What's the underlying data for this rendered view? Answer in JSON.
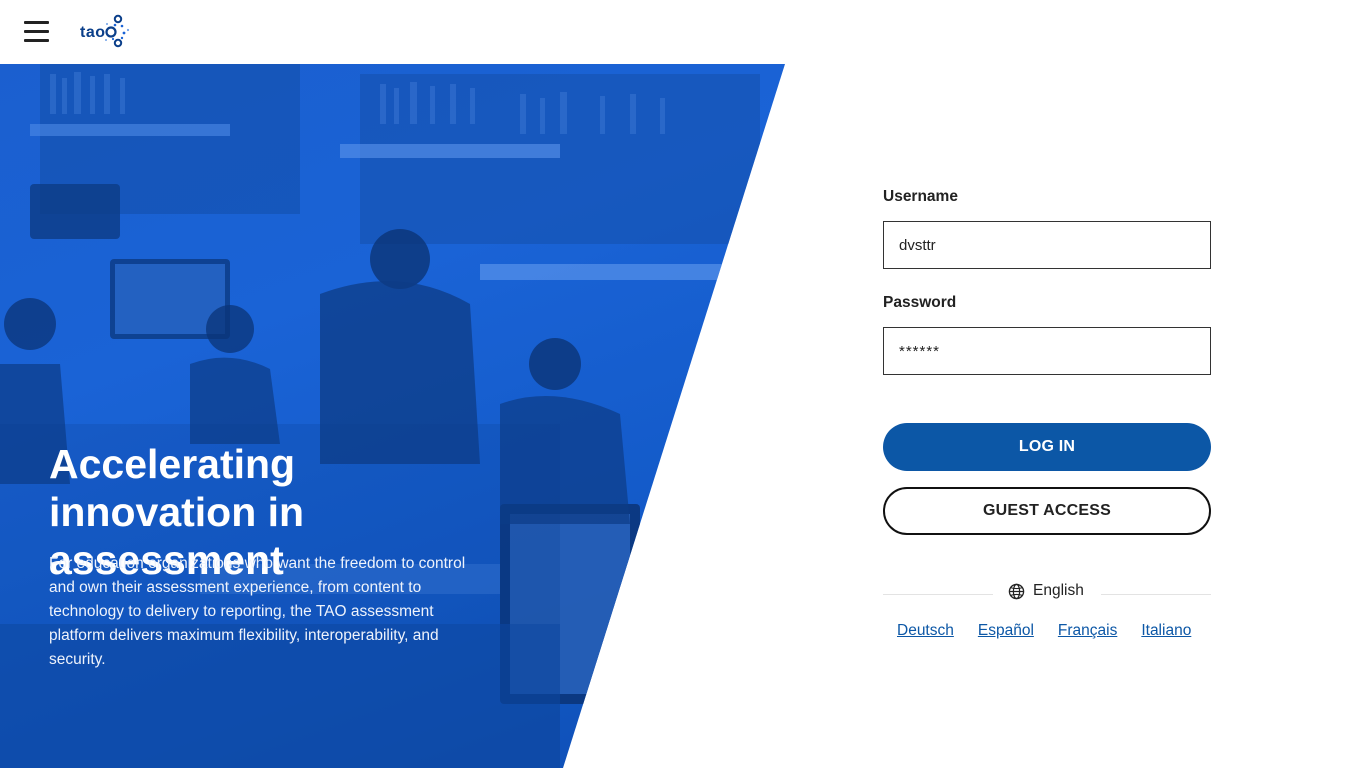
{
  "header": {
    "menu_icon": "hamburger-menu-icon",
    "logo_text": "tao",
    "logo_icon": "tao-dots-logo"
  },
  "hero": {
    "title": "Accelerating innovation in assessment",
    "body": "For education organizations who want the freedom to control and own their assessment experience, from content to technology to delivery to reporting, the TAO assessment platform delivers maximum flexibility, interoperability, and security.",
    "accent_color": "#1a63d6"
  },
  "login": {
    "username_label": "Username",
    "username_value": "dvsttr",
    "password_label": "Password",
    "password_value": "******",
    "login_button": "LOG IN",
    "guest_button": "GUEST ACCESS",
    "login_button_color": "#0c57a6"
  },
  "language": {
    "globe_icon": "globe-icon",
    "current": "English",
    "options": [
      "Deutsch",
      "Español",
      "Français",
      "Italiano"
    ]
  }
}
